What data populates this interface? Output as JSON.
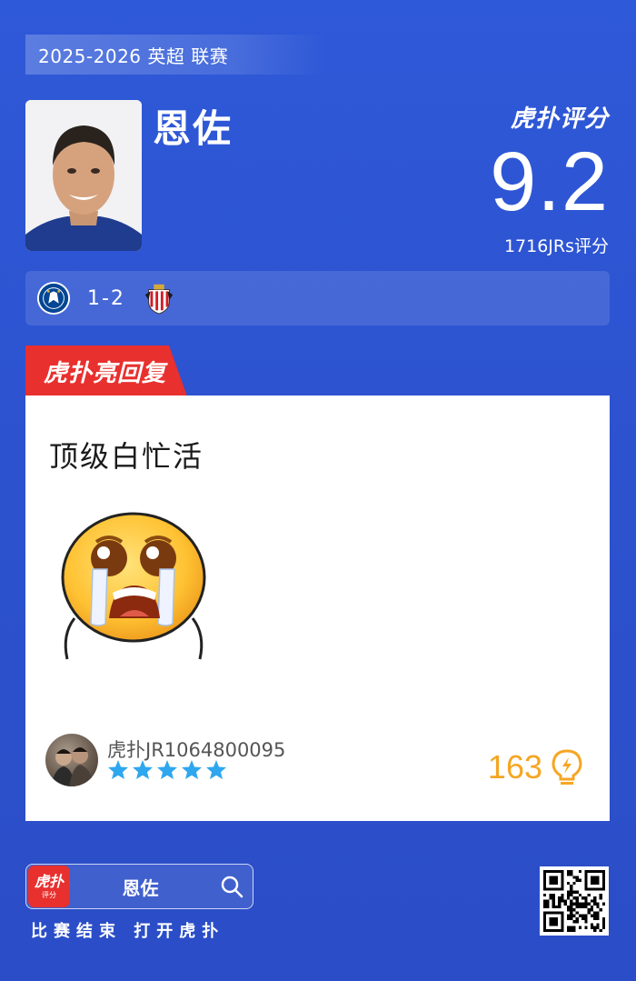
{
  "header": {
    "season": "2025-2026 英超 联赛",
    "player_name": "恩佐",
    "brand": "虎扑评分",
    "score": "9.2",
    "votes": "1716JRs评分"
  },
  "match": {
    "home_team_icon": "chelsea-crest-icon",
    "score": "1-2",
    "away_team_icon": "sunderland-crest-icon"
  },
  "highlight": {
    "tag": "虎扑亮回复",
    "comment": "顶级白忙活",
    "emoji_icon": "crying-face-icon",
    "username": "虎扑JR1064800095",
    "stars": 5,
    "likes": "163",
    "like_icon": "lightbulb-icon"
  },
  "footer": {
    "app_icon_text": "虎扑",
    "app_icon_sub": "评分",
    "search_text": "恩佐",
    "cta": "比赛结束 打开虎扑"
  },
  "colors": {
    "background": "#2d53d0",
    "accent_red": "#e8302e",
    "star_blue": "#2fa7ee",
    "likes_gold": "#f5a623"
  }
}
